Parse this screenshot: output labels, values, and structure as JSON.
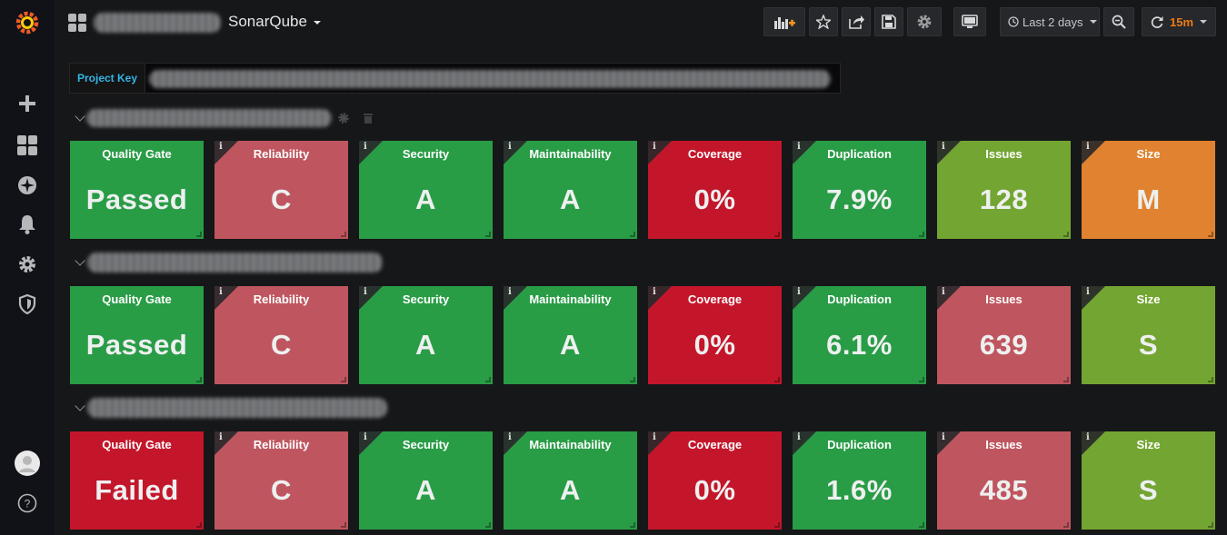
{
  "navbar": {
    "dashboard_title": "SonarQube",
    "time_range_label": "Last 2 days",
    "refresh_interval": "15m"
  },
  "variables": {
    "project_key_label": "Project Key"
  },
  "colors": {
    "passed_green": "#299c46",
    "failed_red": "#c4162a",
    "warn_pink": "#bf565f",
    "orange": "#e0822f",
    "light_green": "#73a532",
    "info_blue": "#33b5e5"
  },
  "rows": [
    {
      "panels": [
        {
          "title": "Quality Gate",
          "value": "Passed",
          "color": "#299c46",
          "info": ""
        },
        {
          "title": "Reliability",
          "value": "C",
          "color": "#bf565f",
          "info": "i"
        },
        {
          "title": "Security",
          "value": "A",
          "color": "#299c46",
          "info": "i"
        },
        {
          "title": "Maintainability",
          "value": "A",
          "color": "#299c46",
          "info": "i"
        },
        {
          "title": "Coverage",
          "value": "0%",
          "color": "#c4162a",
          "info": "i"
        },
        {
          "title": "Duplication",
          "value": "7.9%",
          "color": "#299c46",
          "info": "i"
        },
        {
          "title": "Issues",
          "value": "128",
          "color": "#73a532",
          "info": "i"
        },
        {
          "title": "Size",
          "value": "M",
          "color": "#e0822f",
          "info": "i"
        }
      ]
    },
    {
      "panels": [
        {
          "title": "Quality Gate",
          "value": "Passed",
          "color": "#299c46",
          "info": ""
        },
        {
          "title": "Reliability",
          "value": "C",
          "color": "#bf565f",
          "info": "i"
        },
        {
          "title": "Security",
          "value": "A",
          "color": "#299c46",
          "info": "i"
        },
        {
          "title": "Maintainability",
          "value": "A",
          "color": "#299c46",
          "info": "i"
        },
        {
          "title": "Coverage",
          "value": "0%",
          "color": "#c4162a",
          "info": "i"
        },
        {
          "title": "Duplication",
          "value": "6.1%",
          "color": "#299c46",
          "info": "i"
        },
        {
          "title": "Issues",
          "value": "639",
          "color": "#bf565f",
          "info": "i"
        },
        {
          "title": "Size",
          "value": "S",
          "color": "#73a532",
          "info": "i"
        }
      ]
    },
    {
      "panels": [
        {
          "title": "Quality Gate",
          "value": "Failed",
          "color": "#c4162a",
          "info": ""
        },
        {
          "title": "Reliability",
          "value": "C",
          "color": "#bf565f",
          "info": "i"
        },
        {
          "title": "Security",
          "value": "A",
          "color": "#299c46",
          "info": "i"
        },
        {
          "title": "Maintainability",
          "value": "A",
          "color": "#299c46",
          "info": "i"
        },
        {
          "title": "Coverage",
          "value": "0%",
          "color": "#c4162a",
          "info": "i"
        },
        {
          "title": "Duplication",
          "value": "1.6%",
          "color": "#299c46",
          "info": "i"
        },
        {
          "title": "Issues",
          "value": "485",
          "color": "#bf565f",
          "info": "i"
        },
        {
          "title": "Size",
          "value": "S",
          "color": "#73a532",
          "info": "i"
        }
      ]
    }
  ],
  "sidemenu": {
    "help_glyph": "?"
  }
}
